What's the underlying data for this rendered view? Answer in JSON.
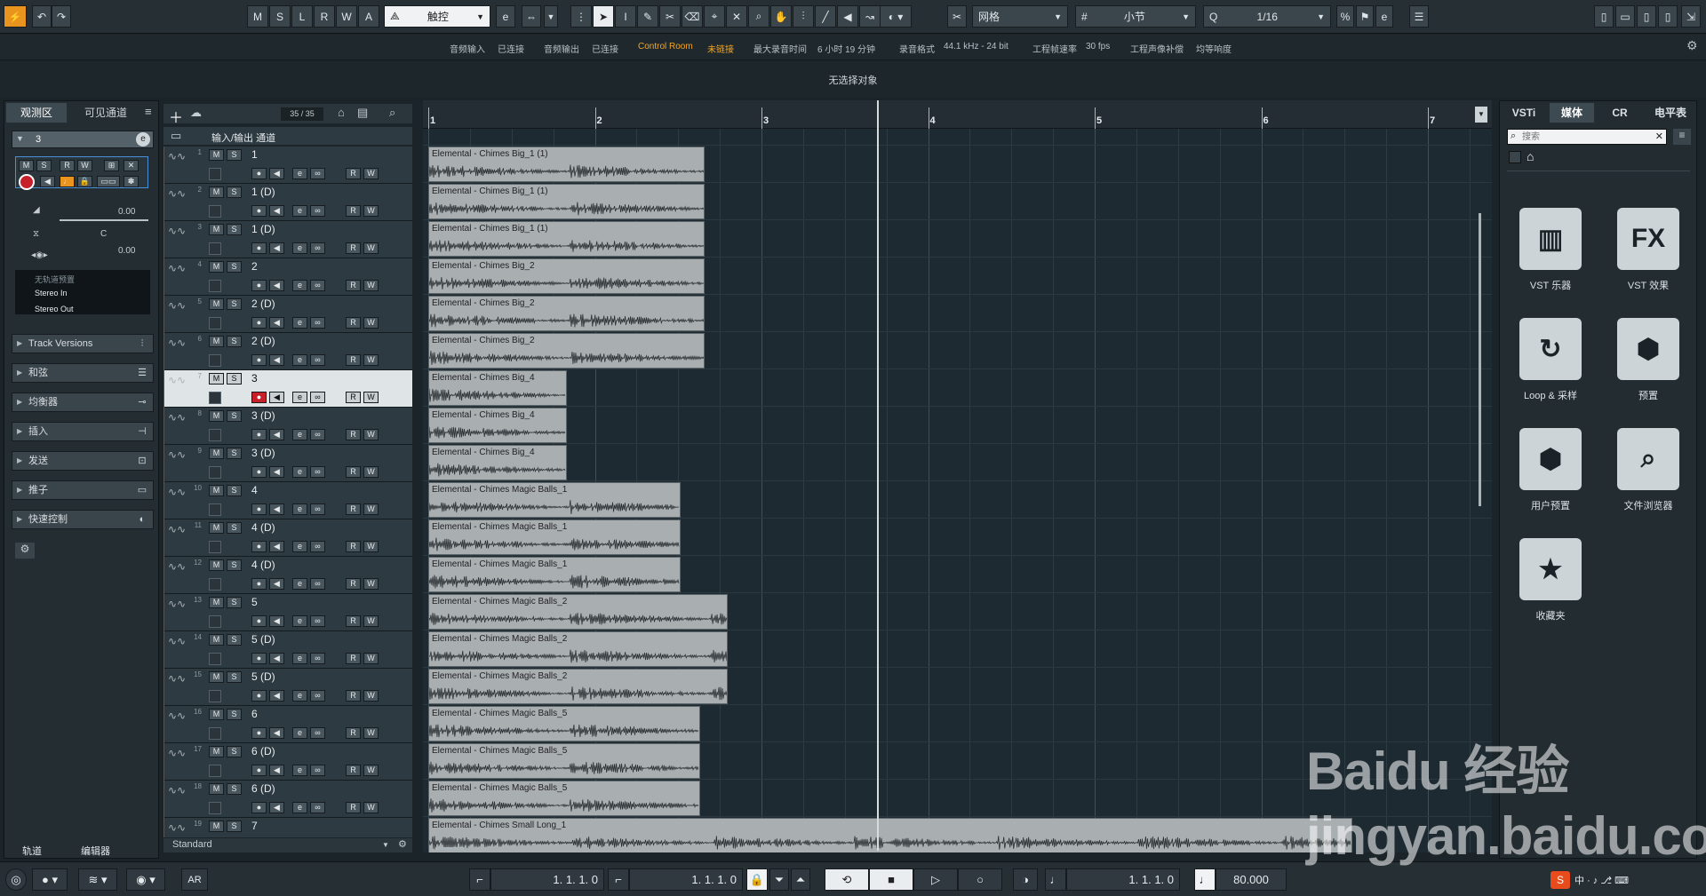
{
  "toolbar": {
    "mode_buttons": [
      "M",
      "S",
      "L",
      "R",
      "W",
      "A"
    ],
    "automation_mode": "触控",
    "snap_type": "网格",
    "grid_type": "小节",
    "quantize": "1/16"
  },
  "infobar": {
    "audio_input_label": "音频输入",
    "audio_input_value": "已连接",
    "audio_output_label": "音频输出",
    "audio_output_value": "已连接",
    "control_room_label": "Control Room",
    "control_room_value": "未链接",
    "max_rec_label": "最大录音时间",
    "max_rec_value": "6 小时 19 分钟",
    "rec_format_label": "录音格式",
    "rec_format_value": "44.1 kHz - 24 bit",
    "frame_rate_label": "工程帧速率",
    "frame_rate_value": "30 fps",
    "pan_label": "工程声像补偿",
    "pan_value": "均等响度"
  },
  "status": "无选择对象",
  "inspector": {
    "tab_inspector": "观测区",
    "tab_visible": "可见通道",
    "track_name": "3",
    "volume": "0.00",
    "pan": "C",
    "delay": "0.00",
    "routing": [
      "无轨道预置",
      "Stereo In",
      "Stereo Out"
    ],
    "sections": [
      "Track Versions",
      "和弦",
      "均衡器",
      "插入",
      "发送",
      "推子",
      "快速控制"
    ],
    "bottom_tab_tracks": "轨道",
    "bottom_tab_editor": "编辑器"
  },
  "tracklist": {
    "count": "35 / 35",
    "folder_name": "输入/输出 通道",
    "preset": "Standard",
    "tracks": [
      {
        "num": "1",
        "name": "1"
      },
      {
        "num": "2",
        "name": "1 (D)"
      },
      {
        "num": "3",
        "name": "1 (D)"
      },
      {
        "num": "4",
        "name": "2"
      },
      {
        "num": "5",
        "name": "2 (D)"
      },
      {
        "num": "6",
        "name": "2 (D)"
      },
      {
        "num": "7",
        "name": "3"
      },
      {
        "num": "8",
        "name": "3 (D)"
      },
      {
        "num": "9",
        "name": "3 (D)"
      },
      {
        "num": "10",
        "name": "4"
      },
      {
        "num": "11",
        "name": "4 (D)"
      },
      {
        "num": "12",
        "name": "4 (D)"
      },
      {
        "num": "13",
        "name": "5"
      },
      {
        "num": "14",
        "name": "5 (D)"
      },
      {
        "num": "15",
        "name": "5 (D)"
      },
      {
        "num": "16",
        "name": "6"
      },
      {
        "num": "17",
        "name": "6 (D)"
      },
      {
        "num": "18",
        "name": "6 (D)"
      },
      {
        "num": "19",
        "name": "7"
      }
    ]
  },
  "ruler": {
    "bars": [
      "1",
      "2",
      "3",
      "4",
      "5",
      "6",
      "7"
    ]
  },
  "events": [
    "Elemental - Chimes Big_1 (1)",
    "Elemental - Chimes Big_1 (1)",
    "Elemental - Chimes Big_1 (1)",
    "Elemental - Chimes Big_2",
    "Elemental - Chimes Big_2",
    "Elemental - Chimes Big_2",
    "Elemental - Chimes Big_4",
    "Elemental - Chimes Big_4",
    "Elemental - Chimes Big_4",
    "Elemental - Chimes Magic Balls_1",
    "Elemental - Chimes Magic Balls_1",
    "Elemental - Chimes Magic Balls_1",
    "Elemental - Chimes Magic Balls_2",
    "Elemental - Chimes Magic Balls_2",
    "Elemental - Chimes Magic Balls_2",
    "Elemental - Chimes Magic Balls_5",
    "Elemental - Chimes Magic Balls_5",
    "Elemental - Chimes Magic Balls_5",
    "Elemental - Chimes Small Long_1"
  ],
  "rightzone": {
    "tabs": [
      "VSTi",
      "媒体",
      "CR",
      "电平表"
    ],
    "search_placeholder": "搜索",
    "tiles": [
      "VST 乐器",
      "VST 效果",
      "Loop & 采样",
      "预置",
      "用户预置",
      "文件浏览器",
      "收藏夹"
    ]
  },
  "transport": {
    "left_locator": "1. 1. 1.   0",
    "right_locator": "1. 1. 1.   0",
    "position": "1. 1. 1.   0",
    "tempo": "80.000"
  },
  "watermark": "Baidu 经验 jingyan.baidu.com",
  "colors": {
    "accent": "#f5a623",
    "event": "#a9aeb1",
    "selected_row": "#dfe4e7",
    "record": "#c8202a"
  }
}
